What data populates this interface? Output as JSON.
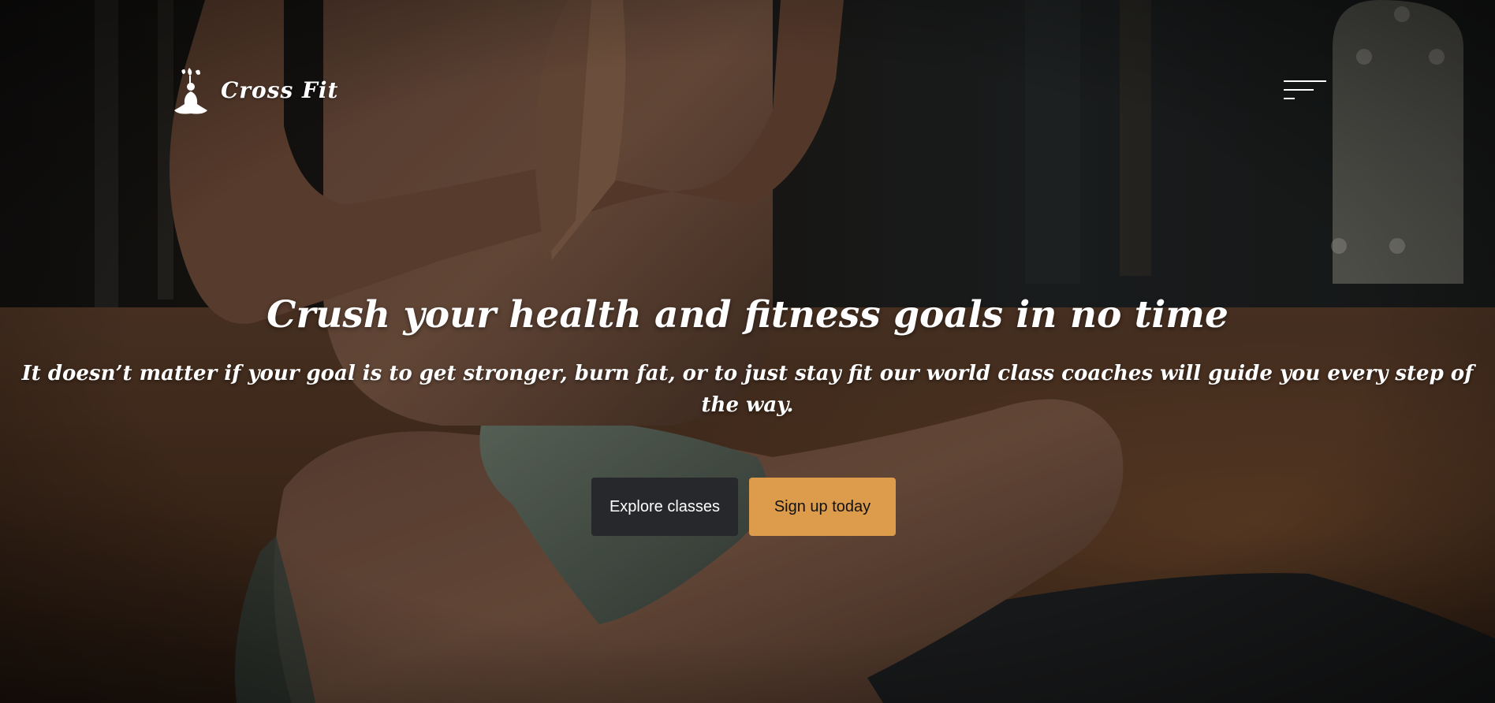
{
  "header": {
    "brand": "Cross Fit",
    "menu_icon": "hamburger-menu-icon",
    "logo_icon": "meditation-figure-icon"
  },
  "hero": {
    "title": "Crush your health and fitness goals in no time",
    "subtitle": "It doesn’t matter if your goal is to get stronger, burn fat, or to just stay fit our world class coaches will guide you every step of the way.",
    "background": "photo of a man sitting cross-legged on a yoga mat with palms pressed together in a dim gym"
  },
  "actions": {
    "explore_label": "Explore classes",
    "signup_label": "Sign up today"
  },
  "colors": {
    "primary_button": "#dd9c4b",
    "secondary_button": "#26282b",
    "text": "#ffffff"
  }
}
